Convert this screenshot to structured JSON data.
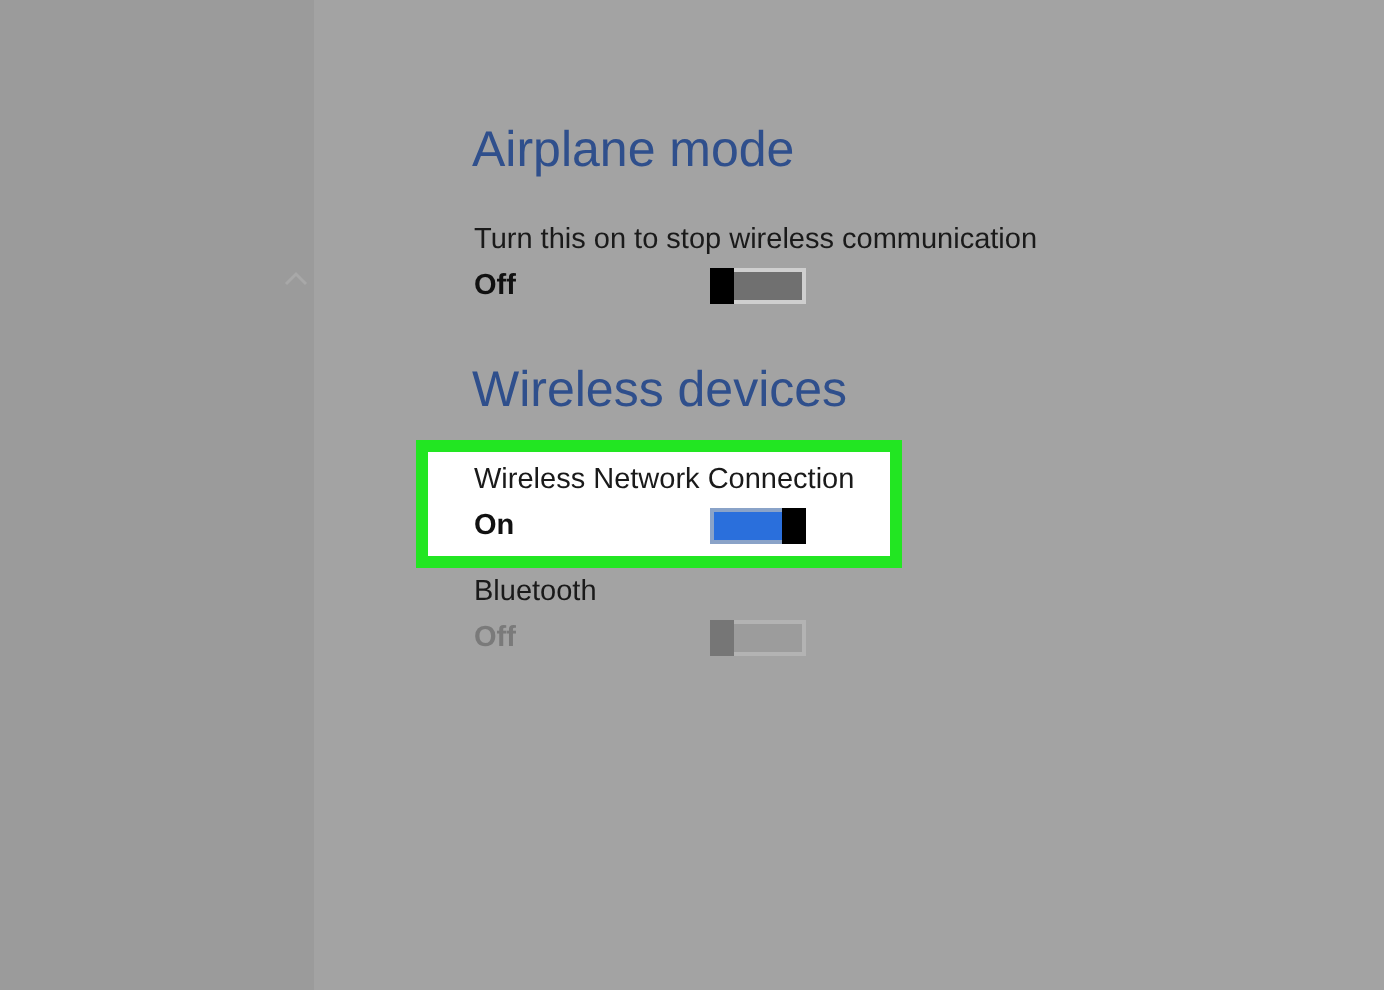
{
  "sections": [
    {
      "title": "Airplane mode",
      "items": [
        {
          "label": "Turn this on to stop wireless communication",
          "state": "Off",
          "on": false,
          "disabled": false,
          "highlighted": false
        }
      ]
    },
    {
      "title": "Wireless devices",
      "items": [
        {
          "label": "Wireless Network Connection",
          "state": "On",
          "on": true,
          "disabled": false,
          "highlighted": true
        },
        {
          "label": "Bluetooth",
          "state": "Off",
          "on": false,
          "disabled": true,
          "highlighted": false
        }
      ]
    }
  ]
}
